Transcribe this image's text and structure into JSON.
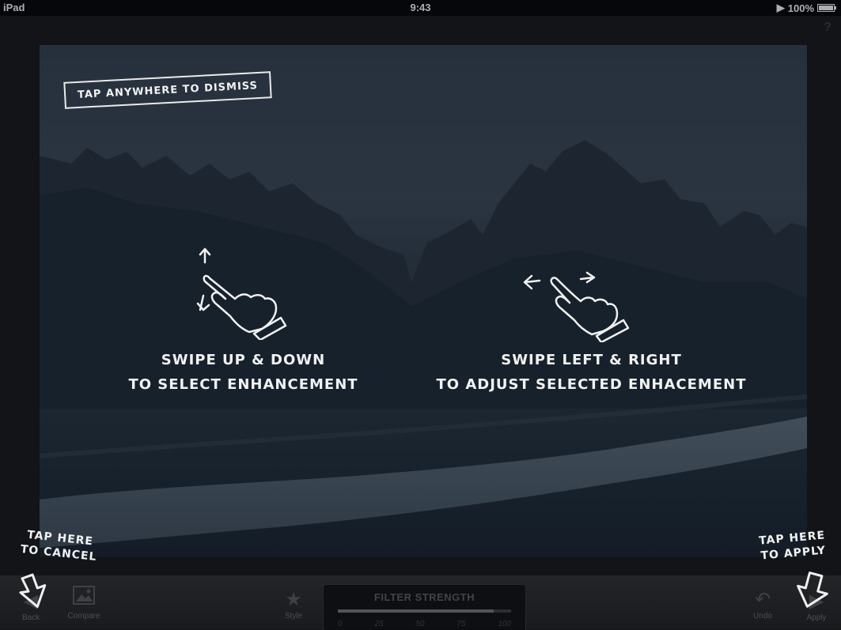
{
  "status_bar": {
    "device": "iPad",
    "time": "9:43",
    "battery": "100%"
  },
  "help_icon": "?",
  "overlay": {
    "dismiss_label": "TAP ANYWHERE TO DISMISS",
    "left_tip": {
      "line1": "SWIPE UP & DOWN",
      "line2": "TO SELECT ENHANCEMENT"
    },
    "right_tip": {
      "line1": "SWIPE LEFT & RIGHT",
      "line2": "TO ADJUST SELECTED ENHACEMENT"
    },
    "cancel_tip": {
      "line1": "TAP HERE",
      "line2": "TO CANCEL"
    },
    "apply_tip": {
      "line1": "TAP HERE",
      "line2": "TO APPLY"
    }
  },
  "toolbar": {
    "back_label": "Back",
    "compare_label": "Compare",
    "style_label": "Style",
    "undo_label": "Undo",
    "apply_label": "Apply",
    "filter": {
      "title": "FILTER STRENGTH",
      "ticks": [
        "0",
        "25",
        "50",
        "75",
        "100"
      ],
      "value_fraction": 0.9
    }
  }
}
